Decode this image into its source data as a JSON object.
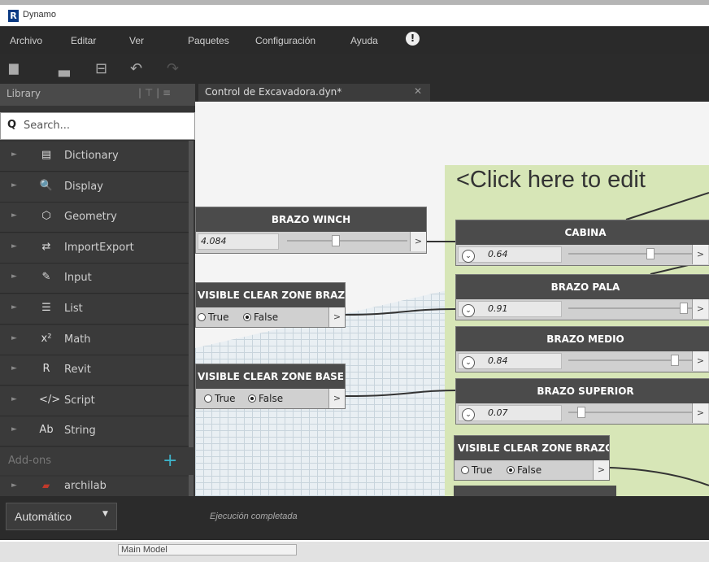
{
  "window": {
    "app_title": "Dynamo",
    "logo_letter": "R"
  },
  "menu": [
    "Archivo",
    "Editar",
    "Ver",
    "Paquetes",
    "Configuración",
    "Ayuda"
  ],
  "toolbar": {
    "icons": [
      "new-file-icon",
      "open-file-icon",
      "save-icon",
      "undo-icon",
      "redo-icon"
    ]
  },
  "library": {
    "title": "Library",
    "search_placeholder": "Search...",
    "categories": [
      {
        "label": "Dictionary",
        "icon": "▤"
      },
      {
        "label": "Display",
        "icon": "🔍"
      },
      {
        "label": "Geometry",
        "icon": "⬡"
      },
      {
        "label": "ImportExport",
        "icon": "⇄"
      },
      {
        "label": "Input",
        "icon": "✎"
      },
      {
        "label": "List",
        "icon": "☰"
      },
      {
        "label": "Math",
        "icon": "x²"
      },
      {
        "label": "Revit",
        "icon": "R"
      },
      {
        "label": "Script",
        "icon": "</>"
      },
      {
        "label": "String",
        "icon": "Ab"
      }
    ],
    "addons_label": "Add-ons",
    "addon_items": [
      {
        "label": "archilab"
      }
    ]
  },
  "tab": {
    "title": "Control de Excavadora.dyn*"
  },
  "canvas": {
    "group_title": "<Click here to edit",
    "nodes": {
      "brazo_winch": {
        "title": "BRAZO WINCH",
        "value": "4.084",
        "level": 0.4
      },
      "visible_clear_zone_brazo_left": {
        "title": "VISIBLE CLEAR ZONE BRAZO",
        "true_label": "True",
        "false_label": "False",
        "selected": "False"
      },
      "visible_clear_zone_base": {
        "title": "VISIBLE CLEAR ZONE BASE",
        "true_label": "True",
        "false_label": "False",
        "selected": "False"
      },
      "cabina": {
        "title": "CABINA",
        "value": "0.64",
        "level": 0.64
      },
      "brazo_pala": {
        "title": "BRAZO PALA",
        "value": "0.91",
        "level": 0.91
      },
      "brazo_medio": {
        "title": "BRAZO MEDIO",
        "value": "0.84",
        "level": 0.84
      },
      "brazo_superior": {
        "title": "BRAZO SUPERIOR",
        "value": "0.07",
        "level": 0.07
      },
      "visible_clear_zone_brazo_right": {
        "title": "VISIBLE CLEAR ZONE BRAZO",
        "true_label": "True",
        "false_label": "False",
        "selected": "False"
      }
    }
  },
  "bottom": {
    "run_mode": "Automático",
    "status": "Ejecución completada"
  },
  "revit": {
    "model_selector": "Main Model"
  }
}
